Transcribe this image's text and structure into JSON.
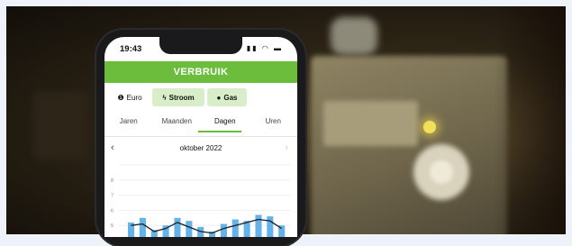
{
  "status": {
    "time": "19:43",
    "icons": "signal wifi battery"
  },
  "app": {
    "title": "VERBRUIK"
  },
  "segments": [
    {
      "label": "Euro",
      "icon": "euro-icon"
    },
    {
      "label": "Stroom",
      "icon": "lightning-icon"
    },
    {
      "label": "Gas",
      "icon": "flame-icon"
    }
  ],
  "tabs": [
    "Jaren",
    "Maanden",
    "Dagen",
    "Uren"
  ],
  "active_tab": "Dagen",
  "period": {
    "label": "oktober 2022"
  },
  "colors": {
    "accent": "#6cbd3b",
    "bar": "#63b3ea",
    "line": "#1d1d1f"
  },
  "chart_data": {
    "type": "bar",
    "y_ticks": [
      "8",
      "7",
      "6",
      "5"
    ],
    "ylim": [
      4,
      9
    ],
    "values": [
      5.2,
      5.5,
      4.7,
      5.0,
      5.5,
      5.3,
      4.9,
      4.6,
      5.1,
      5.4,
      5.3,
      5.7,
      5.6,
      5.0
    ],
    "line": [
      5.0,
      5.1,
      4.6,
      4.8,
      5.2,
      4.9,
      4.6,
      4.5,
      4.8,
      5.0,
      5.2,
      5.4,
      5.3,
      4.8
    ]
  }
}
